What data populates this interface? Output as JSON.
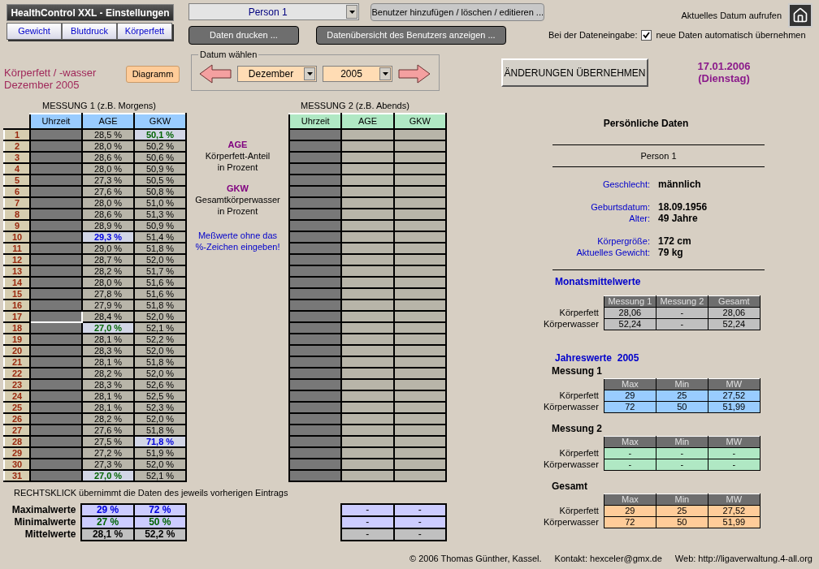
{
  "header": {
    "title": "HealthControl XXL - Einstellungen"
  },
  "tabs": [
    {
      "label": "Gewicht"
    },
    {
      "label": "Blutdruck"
    },
    {
      "label": "Körperfett"
    }
  ],
  "user_select": {
    "value": "Person 1"
  },
  "buttons": {
    "manage_users": "Benutzer hinzufügen / löschen / editieren ...",
    "print": "Daten drucken ...",
    "overview": "Datenübersicht des Benutzers anzeigen ..."
  },
  "current_date_link": {
    "label": "Aktuelles Datum aufrufen"
  },
  "auto_accept": {
    "prefix": "Bei der Dateneingabe:",
    "label": "neue Daten automatisch übernehmen",
    "checked": true
  },
  "page_title": [
    "Körperfett / -wasser",
    "Dezember 2005"
  ],
  "diagram_button": "Diagramm",
  "date_picker": {
    "legend": "Datum wählen",
    "month": "Dezember",
    "year": "2005"
  },
  "apply_button": "ÄNDERUNGEN ÜBERNEHMEN",
  "today": {
    "date": "17.01.2006",
    "weekday": "(Dienstag)"
  },
  "measurement_1": {
    "title": "MESSUNG 1 (z.B. Morgens)",
    "columns": [
      "Uhrzeit",
      "AGE",
      "GKW"
    ],
    "rows": [
      {
        "day": "1",
        "selected": false,
        "age": {
          "text": "28,5 %",
          "kind": "plain"
        },
        "gkw": {
          "text": "50,1 %",
          "kind": "min"
        }
      },
      {
        "day": "2",
        "selected": false,
        "age": {
          "text": "28,0 %",
          "kind": "plain"
        },
        "gkw": {
          "text": "50,2 %",
          "kind": "plain"
        }
      },
      {
        "day": "3",
        "selected": false,
        "age": {
          "text": "28,6 %",
          "kind": "plain"
        },
        "gkw": {
          "text": "50,6 %",
          "kind": "plain"
        }
      },
      {
        "day": "4",
        "selected": false,
        "age": {
          "text": "28,0 %",
          "kind": "plain"
        },
        "gkw": {
          "text": "50,9 %",
          "kind": "plain"
        }
      },
      {
        "day": "5",
        "selected": false,
        "age": {
          "text": "27,3 %",
          "kind": "plain"
        },
        "gkw": {
          "text": "50,5 %",
          "kind": "plain"
        }
      },
      {
        "day": "6",
        "selected": false,
        "age": {
          "text": "27,6 %",
          "kind": "plain"
        },
        "gkw": {
          "text": "50,8 %",
          "kind": "plain"
        }
      },
      {
        "day": "7",
        "selected": false,
        "age": {
          "text": "28,0 %",
          "kind": "plain"
        },
        "gkw": {
          "text": "51,0 %",
          "kind": "plain"
        }
      },
      {
        "day": "8",
        "selected": false,
        "age": {
          "text": "28,6 %",
          "kind": "plain"
        },
        "gkw": {
          "text": "51,3 %",
          "kind": "plain"
        }
      },
      {
        "day": "9",
        "selected": false,
        "age": {
          "text": "28,9 %",
          "kind": "plain"
        },
        "gkw": {
          "text": "50,9 %",
          "kind": "plain"
        }
      },
      {
        "day": "10",
        "selected": false,
        "age": {
          "text": "29,3 %",
          "kind": "max"
        },
        "gkw": {
          "text": "51,4 %",
          "kind": "plain"
        }
      },
      {
        "day": "11",
        "selected": false,
        "age": {
          "text": "29,0 %",
          "kind": "plain"
        },
        "gkw": {
          "text": "51,8 %",
          "kind": "plain"
        }
      },
      {
        "day": "12",
        "selected": false,
        "age": {
          "text": "28,7 %",
          "kind": "plain"
        },
        "gkw": {
          "text": "52,0 %",
          "kind": "plain"
        }
      },
      {
        "day": "13",
        "selected": false,
        "age": {
          "text": "28,2 %",
          "kind": "plain"
        },
        "gkw": {
          "text": "51,7 %",
          "kind": "plain"
        }
      },
      {
        "day": "14",
        "selected": false,
        "age": {
          "text": "28,0 %",
          "kind": "plain"
        },
        "gkw": {
          "text": "51,6 %",
          "kind": "plain"
        }
      },
      {
        "day": "15",
        "selected": false,
        "age": {
          "text": "27,8 %",
          "kind": "plain"
        },
        "gkw": {
          "text": "51,6 %",
          "kind": "plain"
        }
      },
      {
        "day": "16",
        "selected": false,
        "age": {
          "text": "27,9 %",
          "kind": "plain"
        },
        "gkw": {
          "text": "51,8 %",
          "kind": "plain"
        }
      },
      {
        "day": "17",
        "selected": true,
        "age": {
          "text": "28,4 %",
          "kind": "plain"
        },
        "gkw": {
          "text": "52,0 %",
          "kind": "plain"
        }
      },
      {
        "day": "18",
        "selected": false,
        "age": {
          "text": "27,0 %",
          "kind": "min"
        },
        "gkw": {
          "text": "52,1 %",
          "kind": "plain"
        }
      },
      {
        "day": "19",
        "selected": false,
        "age": {
          "text": "28,1 %",
          "kind": "plain"
        },
        "gkw": {
          "text": "52,2 %",
          "kind": "plain"
        }
      },
      {
        "day": "20",
        "selected": false,
        "age": {
          "text": "28,3 %",
          "kind": "plain"
        },
        "gkw": {
          "text": "52,0 %",
          "kind": "plain"
        }
      },
      {
        "day": "21",
        "selected": false,
        "age": {
          "text": "28,1 %",
          "kind": "plain"
        },
        "gkw": {
          "text": "51,8 %",
          "kind": "plain"
        }
      },
      {
        "day": "22",
        "selected": false,
        "age": {
          "text": "28,2 %",
          "kind": "plain"
        },
        "gkw": {
          "text": "52,0 %",
          "kind": "plain"
        }
      },
      {
        "day": "23",
        "selected": false,
        "age": {
          "text": "28,3 %",
          "kind": "plain"
        },
        "gkw": {
          "text": "52,6 %",
          "kind": "plain"
        }
      },
      {
        "day": "24",
        "selected": false,
        "age": {
          "text": "28,1 %",
          "kind": "plain"
        },
        "gkw": {
          "text": "52,5 %",
          "kind": "plain"
        }
      },
      {
        "day": "25",
        "selected": false,
        "age": {
          "text": "28,1 %",
          "kind": "plain"
        },
        "gkw": {
          "text": "52,3 %",
          "kind": "plain"
        }
      },
      {
        "day": "26",
        "selected": false,
        "age": {
          "text": "28,2 %",
          "kind": "plain"
        },
        "gkw": {
          "text": "52,0 %",
          "kind": "plain"
        }
      },
      {
        "day": "27",
        "selected": false,
        "age": {
          "text": "27,6 %",
          "kind": "plain"
        },
        "gkw": {
          "text": "51,8 %",
          "kind": "plain"
        }
      },
      {
        "day": "28",
        "selected": false,
        "age": {
          "text": "27,5 %",
          "kind": "plain"
        },
        "gkw": {
          "text": "71,8 %",
          "kind": "max"
        }
      },
      {
        "day": "29",
        "selected": false,
        "age": {
          "text": "27,2 %",
          "kind": "plain"
        },
        "gkw": {
          "text": "51,9 %",
          "kind": "plain"
        }
      },
      {
        "day": "30",
        "selected": false,
        "age": {
          "text": "27,3 %",
          "kind": "plain"
        },
        "gkw": {
          "text": "52,0 %",
          "kind": "plain"
        }
      },
      {
        "day": "31",
        "selected": false,
        "age": {
          "text": "27,0 %",
          "kind": "min"
        },
        "gkw": {
          "text": "52,1 %",
          "kind": "plain"
        }
      }
    ]
  },
  "legend": [
    {
      "term": "AGE",
      "text": "Körperfett-Anteil\nin Prozent"
    },
    {
      "term": "GKW",
      "text": "Gesamtkörperwasser\nin Prozent"
    }
  ],
  "note": "Meßwerte ohne das %-Zeichen eingeben!",
  "measurement_2": {
    "title": "MESSUNG 2 (z.B. Abends)",
    "columns": [
      "Uhrzeit",
      "AGE",
      "GKW"
    ]
  },
  "hint": "RECHTSKLICK übernimmt die Daten des jeweils vorherigen Eintrags",
  "summary_1": [
    {
      "label": "Maximalwerte",
      "kind": "max",
      "values": [
        "29 %",
        "72 %"
      ]
    },
    {
      "label": "Minimalwerte",
      "kind": "min",
      "values": [
        "27 %",
        "50 %"
      ]
    },
    {
      "label": "Mittelwerte",
      "kind": "mean",
      "values": [
        "28,1 %",
        "52,2 %"
      ]
    }
  ],
  "summary_2": [
    {
      "kind": "max",
      "values": [
        "-",
        "-"
      ]
    },
    {
      "kind": "min",
      "values": [
        "-",
        "-"
      ]
    },
    {
      "kind": "mean",
      "values": [
        "-",
        "-"
      ]
    }
  ],
  "personal": {
    "title": "Persönliche Daten",
    "name": "Person 1",
    "groups": [
      [
        {
          "label": "Geschlecht:",
          "value": "männlich"
        }
      ],
      [
        {
          "label": "Geburtsdatum:",
          "value": "18.09.1956"
        },
        {
          "label": "Alter:",
          "value": "49 Jahre"
        }
      ],
      [
        {
          "label": "Körpergröße:",
          "value": "172 cm"
        },
        {
          "label": "Aktuelles Gewicht:",
          "value": "79 kg"
        }
      ]
    ]
  },
  "monthly": {
    "title": "Monatsmittelwerte",
    "color": "#c0c0c0",
    "columns": [
      "Messung 1",
      "Messung 2",
      "Gesamt"
    ],
    "rows": [
      {
        "label": "Körperfett",
        "values": [
          "28,06",
          "-",
          "28,06"
        ]
      },
      {
        "label": "Körperwasser",
        "values": [
          "52,24",
          "-",
          "52,24"
        ]
      }
    ]
  },
  "yearly": {
    "title": "Jahreswerte  2005",
    "tables": [
      {
        "title": "Messung 1",
        "color": "#99ccff",
        "columns": [
          "Max",
          "Min",
          "MW"
        ],
        "rows": [
          {
            "label": "Körperfett",
            "values": [
              "29",
              "25",
              "27,52"
            ]
          },
          {
            "label": "Körperwasser",
            "values": [
              "72",
              "50",
              "51,99"
            ]
          }
        ]
      },
      {
        "title": "Messung 2",
        "color": "#b0e8c4",
        "columns": [
          "Max",
          "Min",
          "MW"
        ],
        "rows": [
          {
            "label": "Körperfett",
            "values": [
              "-",
              "-",
              "-"
            ]
          },
          {
            "label": "Körperwasser",
            "values": [
              "-",
              "-",
              "-"
            ]
          }
        ]
      },
      {
        "title": "Gesamt",
        "color": "#ffcc99",
        "columns": [
          "Max",
          "Min",
          "MW"
        ],
        "rows": [
          {
            "label": "Körperfett",
            "values": [
              "29",
              "25",
              "27,52"
            ]
          },
          {
            "label": "Körperwasser",
            "values": [
              "72",
              "50",
              "51,99"
            ]
          }
        ]
      }
    ]
  },
  "footer": [
    "© 2006 Thomas Günther, Kassel.",
    "Kontakt: hexceler@gmx.de",
    "Web: http://ligaverwaltung.4-all.org"
  ]
}
